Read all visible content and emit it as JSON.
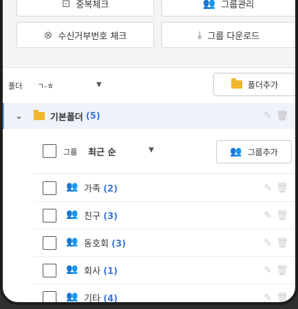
{
  "top_buttons": [
    {
      "label": "중복체크",
      "icon": "duplicate-check-icon"
    },
    {
      "label": "그룹관리",
      "icon": "group-manage-icon"
    },
    {
      "label": "수신거부번호 체크",
      "icon": "circle-x-icon"
    },
    {
      "label": "그룹 다운로드",
      "icon": "download-icon"
    }
  ],
  "folder_filter": {
    "label": "폴더",
    "value": "ㄱ-ㅎ"
  },
  "add_folder_label": "폴더추가",
  "folder": {
    "name": "기본폴더",
    "count": "(5)"
  },
  "group_filter": {
    "label": "그룹",
    "value": "최근 순"
  },
  "add_group_label": "그룹추가",
  "groups": [
    {
      "name": "가족",
      "count": "(2)"
    },
    {
      "name": "친구",
      "count": "(3)"
    },
    {
      "name": "동호회",
      "count": "(3)"
    },
    {
      "name": "회사",
      "count": "(1)"
    },
    {
      "name": "기타",
      "count": "(4)"
    }
  ],
  "colors": {
    "accent": "#3b76e0",
    "folder": "#f2b530",
    "group_icon": "#e86a4f",
    "selected_bg": "#eef2f9"
  }
}
